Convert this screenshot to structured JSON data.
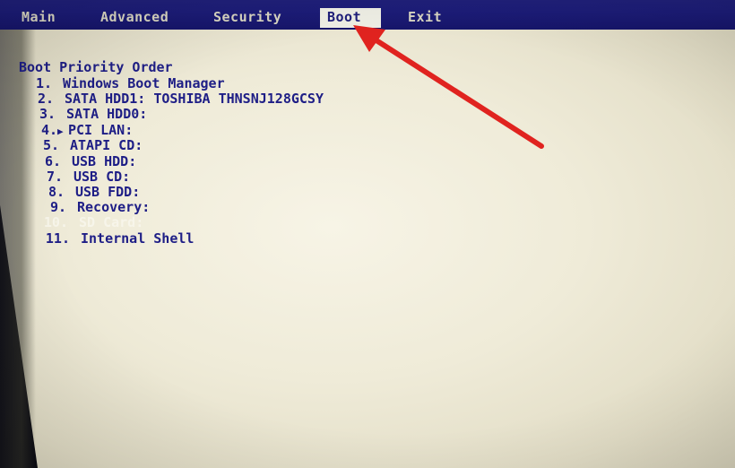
{
  "menubar": {
    "tabs": [
      {
        "label": "Main",
        "active": false
      },
      {
        "label": "Advanced",
        "active": false
      },
      {
        "label": "Security",
        "active": false
      },
      {
        "label": "Boot",
        "active": true
      },
      {
        "label": "Exit",
        "active": false
      }
    ]
  },
  "boot": {
    "title": "Boot Priority Order",
    "items": [
      {
        "number": "1.",
        "marker": "",
        "label": "Windows Boot Manager"
      },
      {
        "number": "2.",
        "marker": "",
        "label": "SATA HDD1: TOSHIBA THNSNJ128GCSY"
      },
      {
        "number": "3.",
        "marker": "",
        "label": "SATA HDD0:"
      },
      {
        "number": "4.",
        "marker": "▶",
        "label": "PCI LAN:"
      },
      {
        "number": "5.",
        "marker": "",
        "label": "ATAPI CD:"
      },
      {
        "number": "6.",
        "marker": "",
        "label": "USB HDD:"
      },
      {
        "number": "7.",
        "marker": "",
        "label": "USB CD:"
      },
      {
        "number": "8.",
        "marker": "",
        "label": "USB FDD:"
      },
      {
        "number": "9.",
        "marker": "",
        "label": "Recovery:"
      },
      {
        "number": "10.",
        "marker": "",
        "label": "SD Card:"
      },
      {
        "number": "11.",
        "marker": "",
        "label": "Internal Shell"
      }
    ]
  },
  "annotation": {
    "type": "arrow",
    "color": "#e0231f",
    "points_to": "Boot"
  },
  "colors": {
    "menubar_bg": "#1c1c78",
    "menu_text": "#d9d6c2",
    "active_tab_bg": "#efefe5",
    "active_tab_text": "#1e1e7a",
    "panel_bg": "#f3f0e0",
    "item_text": "#1e1e86",
    "highlight_text": "#f7f5ea"
  }
}
